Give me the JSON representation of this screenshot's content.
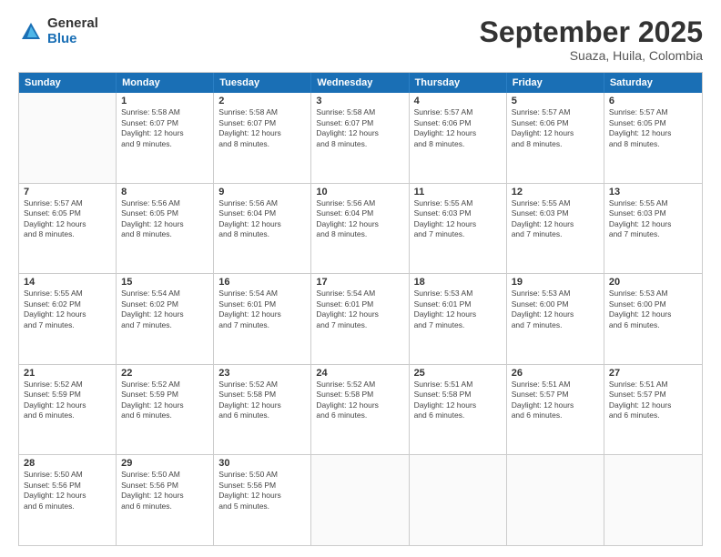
{
  "logo": {
    "general": "General",
    "blue": "Blue"
  },
  "title": "September 2025",
  "subtitle": "Suaza, Huila, Colombia",
  "header_days": [
    "Sunday",
    "Monday",
    "Tuesday",
    "Wednesday",
    "Thursday",
    "Friday",
    "Saturday"
  ],
  "weeks": [
    [
      {
        "day": "",
        "info": ""
      },
      {
        "day": "1",
        "info": "Sunrise: 5:58 AM\nSunset: 6:07 PM\nDaylight: 12 hours\nand 9 minutes."
      },
      {
        "day": "2",
        "info": "Sunrise: 5:58 AM\nSunset: 6:07 PM\nDaylight: 12 hours\nand 8 minutes."
      },
      {
        "day": "3",
        "info": "Sunrise: 5:58 AM\nSunset: 6:07 PM\nDaylight: 12 hours\nand 8 minutes."
      },
      {
        "day": "4",
        "info": "Sunrise: 5:57 AM\nSunset: 6:06 PM\nDaylight: 12 hours\nand 8 minutes."
      },
      {
        "day": "5",
        "info": "Sunrise: 5:57 AM\nSunset: 6:06 PM\nDaylight: 12 hours\nand 8 minutes."
      },
      {
        "day": "6",
        "info": "Sunrise: 5:57 AM\nSunset: 6:05 PM\nDaylight: 12 hours\nand 8 minutes."
      }
    ],
    [
      {
        "day": "7",
        "info": "Sunrise: 5:57 AM\nSunset: 6:05 PM\nDaylight: 12 hours\nand 8 minutes."
      },
      {
        "day": "8",
        "info": "Sunrise: 5:56 AM\nSunset: 6:05 PM\nDaylight: 12 hours\nand 8 minutes."
      },
      {
        "day": "9",
        "info": "Sunrise: 5:56 AM\nSunset: 6:04 PM\nDaylight: 12 hours\nand 8 minutes."
      },
      {
        "day": "10",
        "info": "Sunrise: 5:56 AM\nSunset: 6:04 PM\nDaylight: 12 hours\nand 8 minutes."
      },
      {
        "day": "11",
        "info": "Sunrise: 5:55 AM\nSunset: 6:03 PM\nDaylight: 12 hours\nand 7 minutes."
      },
      {
        "day": "12",
        "info": "Sunrise: 5:55 AM\nSunset: 6:03 PM\nDaylight: 12 hours\nand 7 minutes."
      },
      {
        "day": "13",
        "info": "Sunrise: 5:55 AM\nSunset: 6:03 PM\nDaylight: 12 hours\nand 7 minutes."
      }
    ],
    [
      {
        "day": "14",
        "info": "Sunrise: 5:55 AM\nSunset: 6:02 PM\nDaylight: 12 hours\nand 7 minutes."
      },
      {
        "day": "15",
        "info": "Sunrise: 5:54 AM\nSunset: 6:02 PM\nDaylight: 12 hours\nand 7 minutes."
      },
      {
        "day": "16",
        "info": "Sunrise: 5:54 AM\nSunset: 6:01 PM\nDaylight: 12 hours\nand 7 minutes."
      },
      {
        "day": "17",
        "info": "Sunrise: 5:54 AM\nSunset: 6:01 PM\nDaylight: 12 hours\nand 7 minutes."
      },
      {
        "day": "18",
        "info": "Sunrise: 5:53 AM\nSunset: 6:01 PM\nDaylight: 12 hours\nand 7 minutes."
      },
      {
        "day": "19",
        "info": "Sunrise: 5:53 AM\nSunset: 6:00 PM\nDaylight: 12 hours\nand 7 minutes."
      },
      {
        "day": "20",
        "info": "Sunrise: 5:53 AM\nSunset: 6:00 PM\nDaylight: 12 hours\nand 6 minutes."
      }
    ],
    [
      {
        "day": "21",
        "info": "Sunrise: 5:52 AM\nSunset: 5:59 PM\nDaylight: 12 hours\nand 6 minutes."
      },
      {
        "day": "22",
        "info": "Sunrise: 5:52 AM\nSunset: 5:59 PM\nDaylight: 12 hours\nand 6 minutes."
      },
      {
        "day": "23",
        "info": "Sunrise: 5:52 AM\nSunset: 5:58 PM\nDaylight: 12 hours\nand 6 minutes."
      },
      {
        "day": "24",
        "info": "Sunrise: 5:52 AM\nSunset: 5:58 PM\nDaylight: 12 hours\nand 6 minutes."
      },
      {
        "day": "25",
        "info": "Sunrise: 5:51 AM\nSunset: 5:58 PM\nDaylight: 12 hours\nand 6 minutes."
      },
      {
        "day": "26",
        "info": "Sunrise: 5:51 AM\nSunset: 5:57 PM\nDaylight: 12 hours\nand 6 minutes."
      },
      {
        "day": "27",
        "info": "Sunrise: 5:51 AM\nSunset: 5:57 PM\nDaylight: 12 hours\nand 6 minutes."
      }
    ],
    [
      {
        "day": "28",
        "info": "Sunrise: 5:50 AM\nSunset: 5:56 PM\nDaylight: 12 hours\nand 6 minutes."
      },
      {
        "day": "29",
        "info": "Sunrise: 5:50 AM\nSunset: 5:56 PM\nDaylight: 12 hours\nand 6 minutes."
      },
      {
        "day": "30",
        "info": "Sunrise: 5:50 AM\nSunset: 5:56 PM\nDaylight: 12 hours\nand 5 minutes."
      },
      {
        "day": "",
        "info": ""
      },
      {
        "day": "",
        "info": ""
      },
      {
        "day": "",
        "info": ""
      },
      {
        "day": "",
        "info": ""
      }
    ]
  ]
}
